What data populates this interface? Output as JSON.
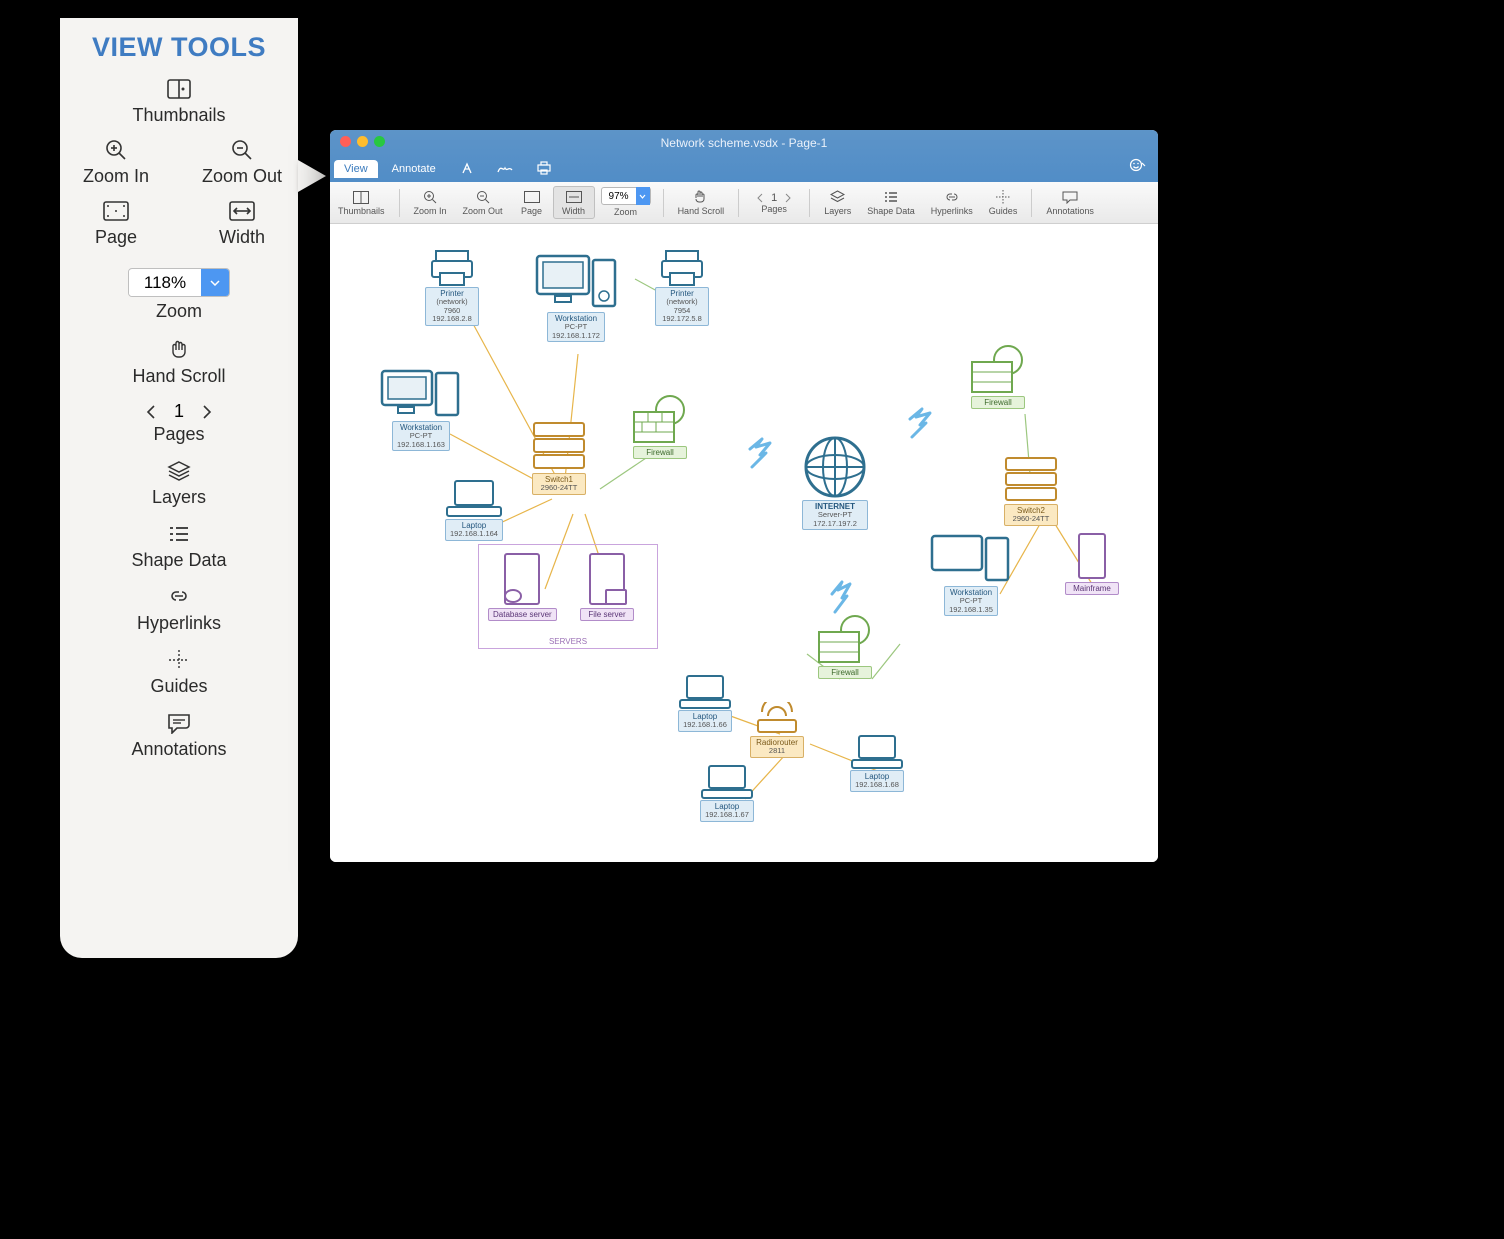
{
  "callout": {
    "title": "VIEW TOOLS",
    "thumbnails": "Thumbnails",
    "zoom_in": "Zoom In",
    "zoom_out": "Zoom Out",
    "page": "Page",
    "width": "Width",
    "zoom_value": "118%",
    "zoom_label": "Zoom",
    "hand_scroll": "Hand Scroll",
    "page_number": "1",
    "pages_label": "Pages",
    "layers": "Layers",
    "shape_data": "Shape Data",
    "hyperlinks": "Hyperlinks",
    "guides": "Guides",
    "annotations": "Annotations"
  },
  "window": {
    "title": "Network scheme.vsdx - Page-1",
    "tab_view": "View",
    "tab_annotate": "Annotate"
  },
  "toolbar": {
    "thumbnails": "Thumbnails",
    "zoom_in": "Zoom In",
    "zoom_out": "Zoom Out",
    "page": "Page",
    "width": "Width",
    "zoom_value": "97%",
    "zoom_label": "Zoom",
    "hand_scroll": "Hand Scroll",
    "page_number": "1",
    "pages_label": "Pages",
    "layers": "Layers",
    "shape_data": "Shape Data",
    "hyperlinks": "Hyperlinks",
    "guides": "Guides",
    "annotations": "Annotations"
  },
  "diagram": {
    "printer1": {
      "l1": "Printer",
      "l2": "(network)",
      "l3": "7960",
      "l4": "192.168.2.8"
    },
    "printer2": {
      "l1": "Printer",
      "l2": "(network)",
      "l3": "7954",
      "l4": "192.172.5.8"
    },
    "ws_top": {
      "l1": "Workstation",
      "l2": "PC-PT",
      "l3": "192.168.1.172"
    },
    "ws_left": {
      "l1": "Workstation",
      "l2": "PC-PT",
      "l3": "192.168.1.163"
    },
    "laptop_left": {
      "l1": "Laptop",
      "l2": "192.168.1.164"
    },
    "switch1": {
      "l1": "Switch1",
      "l2": "2960-24TT"
    },
    "firewall_mid": {
      "l1": "Firewall"
    },
    "db_server": {
      "l1": "Database server"
    },
    "file_server": {
      "l1": "File server"
    },
    "servers_group": "SERVERS",
    "internet": {
      "l1": "INTERNET",
      "l2": "Server-PT",
      "l3": "172.17.197.2"
    },
    "firewall_right": {
      "l1": "Firewall"
    },
    "switch2": {
      "l1": "Switch2",
      "l2": "2960-24TT"
    },
    "ws_right": {
      "l1": "Workstation",
      "l2": "PC-PT",
      "l3": "192.168.1.35"
    },
    "mainframe": {
      "l1": "Mainframe"
    },
    "firewall_bottom": {
      "l1": "Firewall"
    },
    "laptop_b1": {
      "l1": "Laptop",
      "l2": "192.168.1.66"
    },
    "laptop_b2": {
      "l1": "Laptop",
      "l2": "192.168.1.67"
    },
    "laptop_b3": {
      "l1": "Laptop",
      "l2": "192.168.1.68"
    },
    "radiorouter": {
      "l1": "Radiorouter",
      "l2": "2811"
    }
  }
}
